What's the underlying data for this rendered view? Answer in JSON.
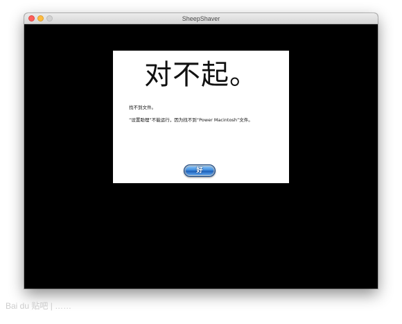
{
  "window": {
    "title": "SheepShaver",
    "traffic_lights": {
      "close": "#fc605c",
      "minimize": "#fdbc40",
      "zoom": "#d2d2d2"
    }
  },
  "dialog": {
    "headline": "对不起。",
    "message_1": "找不到文件。",
    "message_2": "“设置助理”不能运行，因为找不到“Power Macintosh”文件。",
    "ok_label": "好",
    "ok_color": "#3f8de0"
  },
  "watermark": {
    "text": "Bai du 贴吧 | ……"
  }
}
